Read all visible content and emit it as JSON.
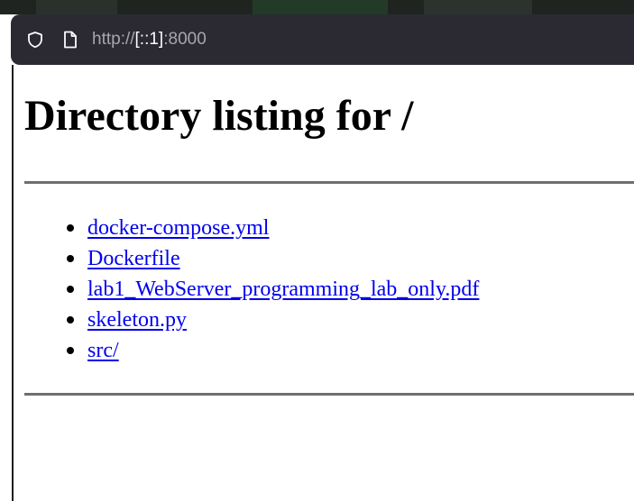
{
  "browser": {
    "url_scheme": "http://",
    "url_host": "[::1]",
    "url_port": ":8000",
    "icons": [
      "shield-icon",
      "page-icon"
    ],
    "colors": {
      "urlbar_bg": "#2b2a33",
      "url_text": "#fbfbfe",
      "url_dim": "#a7a6ad"
    }
  },
  "page": {
    "heading": "Directory listing for /",
    "entries": [
      {
        "label": "docker-compose.yml"
      },
      {
        "label": "Dockerfile"
      },
      {
        "label": "lab1_WebServer_programming_lab_only.pdf"
      },
      {
        "label": "skeleton.py"
      },
      {
        "label": "src/"
      }
    ],
    "colors": {
      "link": "#0000ee",
      "rule": "#6e6e6e"
    }
  }
}
